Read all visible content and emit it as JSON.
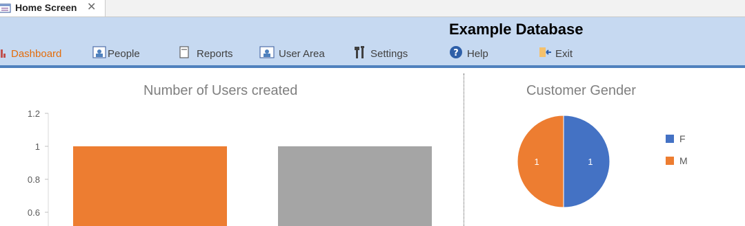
{
  "tab": {
    "title": "Home Screen",
    "close_glyph": "✕",
    "icon": "form-icon"
  },
  "header": {
    "title": "Example Database",
    "nav": [
      {
        "label": "Dashboard",
        "icon": "bar-chart-icon",
        "active": true
      },
      {
        "label": "People",
        "icon": "people-icon"
      },
      {
        "label": "Reports",
        "icon": "report-icon"
      },
      {
        "label": "User Area",
        "icon": "user-area-icon"
      },
      {
        "label": "Settings",
        "icon": "settings-icon"
      },
      {
        "label": "Help",
        "icon": "help-icon"
      },
      {
        "label": "Exit",
        "icon": "exit-icon"
      }
    ]
  },
  "colors": {
    "accent": "#4f81bd",
    "header_bg": "#c6d9f1",
    "orange": "#ed7d31",
    "gray": "#a5a5a5",
    "blue": "#4472c4"
  },
  "chart_data": [
    {
      "type": "bar",
      "title": "Number of Users created",
      "categories": [
        "",
        ""
      ],
      "values": [
        1,
        1
      ],
      "colors": [
        "#ed7d31",
        "#a5a5a5"
      ],
      "ylim": [
        0.6,
        1.2
      ],
      "yticks": [
        "1.2",
        "1",
        "0.8",
        "0.6"
      ],
      "ytick_values": [
        1.2,
        1.0,
        0.8,
        0.6
      ]
    },
    {
      "type": "pie",
      "title": "Customer Gender",
      "labels": [
        "F",
        "M"
      ],
      "values": [
        1,
        1
      ],
      "data_labels": [
        "1",
        "1"
      ],
      "colors": [
        "#4472c4",
        "#ed7d31"
      ],
      "legend_position": "right"
    }
  ]
}
